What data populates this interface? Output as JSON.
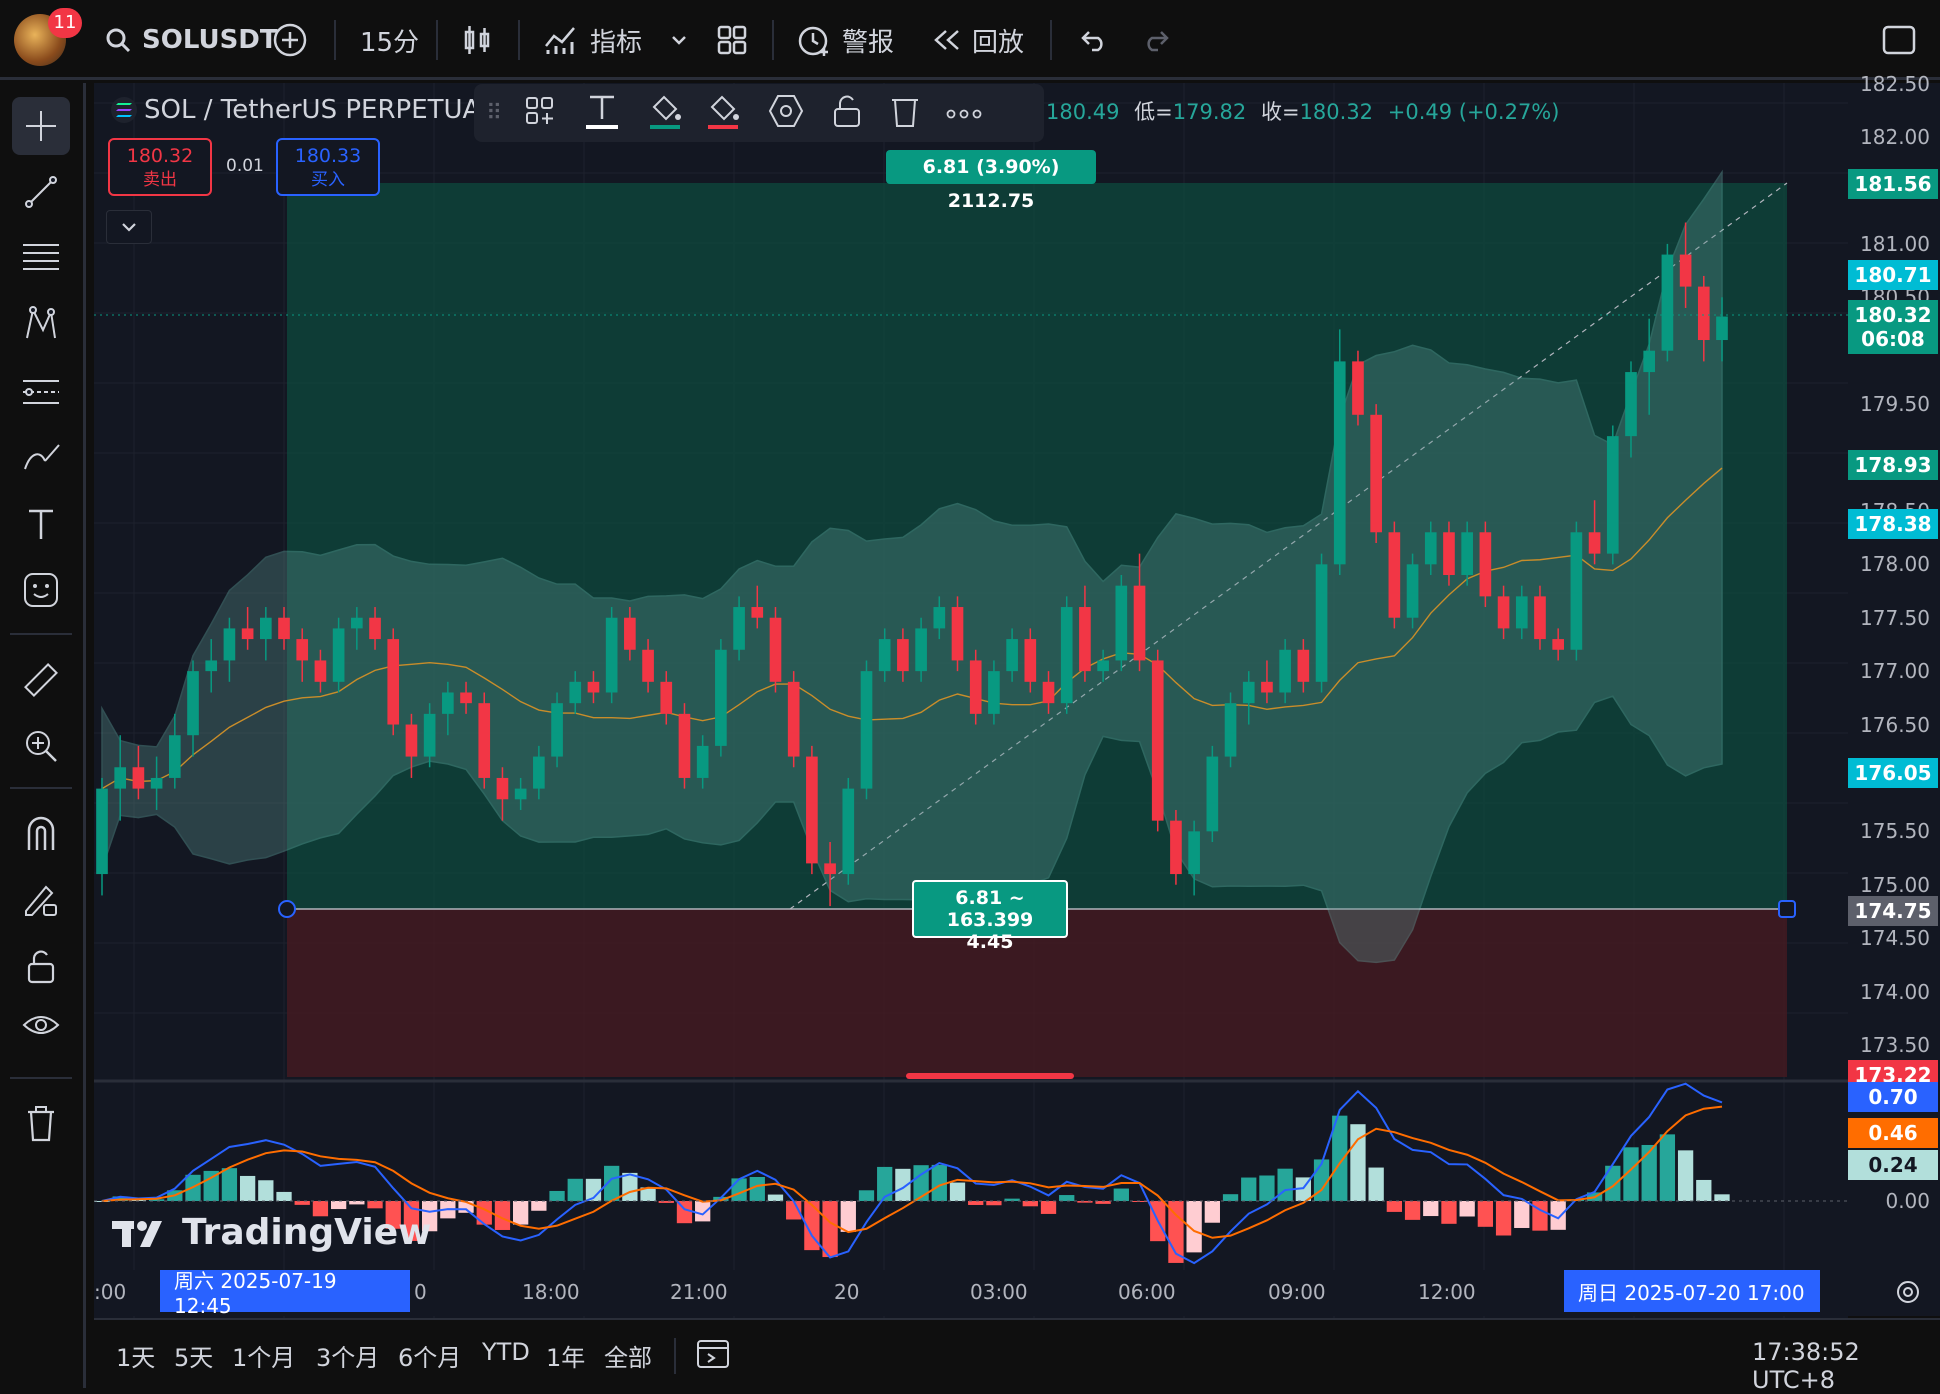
{
  "topbar": {
    "notification_count": "11",
    "symbol": "SOLUSDT",
    "interval": "15分",
    "indicators_label": "指标",
    "alert_label": "警报",
    "replay_label": "回放"
  },
  "legend": {
    "title": "SOL / TetherUS PERPETUA",
    "ohlc_prefix": "180.49",
    "low_label": "低=",
    "low_value": "179.82",
    "close_label": "收=",
    "close_value": "180.32",
    "change": "+0.49 (+0.27%)"
  },
  "trade": {
    "sell_price": "180.32",
    "sell_label": "卖出",
    "spread": "0.01",
    "buy_price": "180.33",
    "buy_label": "买入"
  },
  "position_tool": {
    "top_label": "6.81 (3.90%) 2112.75",
    "mid_label_line1": "6.81 ~ 163.399",
    "mid_label_line2": "4.45"
  },
  "price_axis": {
    "labels": [
      "182.50",
      "182.00",
      "181.00",
      "180.50",
      "179.50",
      "178.50",
      "178.00",
      "177.50",
      "177.00",
      "176.50",
      "175.50",
      "175.00",
      "174.50",
      "174.00",
      "173.50"
    ],
    "tags": [
      {
        "value": "181.56",
        "color": "#089981"
      },
      {
        "value": "180.71",
        "color": "#00bcd4"
      },
      {
        "value": "180.32",
        "sub": "06:08",
        "color": "#089981"
      },
      {
        "value": "178.93",
        "color": "#089981"
      },
      {
        "value": "178.38",
        "color": "#00bcd4"
      },
      {
        "value": "176.05",
        "color": "#00bcd4"
      },
      {
        "value": "174.75",
        "color": "#5d606b"
      },
      {
        "value": "173.22",
        "color": "#f23645"
      }
    ],
    "macd_tags": [
      {
        "value": "0.70",
        "color": "#2962ff"
      },
      {
        "value": "0.46",
        "color": "#ff6d00"
      },
      {
        "value": "0.24",
        "color": "#b2dfdb",
        "text": "#131722"
      }
    ],
    "macd_zero": "0.00"
  },
  "time_axis": {
    "left_cut": ":00",
    "start_tag": "周六 2025-07-19   12:45",
    "after_start": "0",
    "labels": [
      "18:00",
      "21:00",
      "20",
      "03:00",
      "06:00",
      "09:00",
      "12:00"
    ],
    "end_tag": "周日 2025-07-20   17:00"
  },
  "bottombar": {
    "ranges": [
      "1天",
      "5天",
      "1个月",
      "3个月",
      "6个月",
      "YTD",
      "1年",
      "全部"
    ],
    "clock": "17:38:52 UTC+8"
  },
  "watermark": "TradingView",
  "colors": {
    "up": "#089981",
    "down": "#f23645",
    "bg": "#131722",
    "accent": "#2962ff"
  },
  "chart_data": {
    "type": "candlestick",
    "ylim": [
      173.2,
      182.6
    ],
    "candles": [
      [
        175.1,
        176.0,
        174.9,
        175.9
      ],
      [
        175.9,
        176.4,
        175.6,
        176.1
      ],
      [
        176.1,
        176.3,
        175.8,
        175.9
      ],
      [
        175.9,
        176.2,
        175.7,
        176.0
      ],
      [
        176.0,
        176.6,
        175.9,
        176.4
      ],
      [
        176.4,
        177.1,
        176.2,
        177.0
      ],
      [
        177.0,
        177.3,
        176.8,
        177.1
      ],
      [
        177.1,
        177.5,
        176.9,
        177.4
      ],
      [
        177.4,
        177.6,
        177.2,
        177.3
      ],
      [
        177.3,
        177.6,
        177.1,
        177.5
      ],
      [
        177.5,
        177.6,
        177.2,
        177.3
      ],
      [
        177.3,
        177.4,
        176.9,
        177.1
      ],
      [
        177.1,
        177.2,
        176.8,
        176.9
      ],
      [
        176.9,
        177.5,
        176.8,
        177.4
      ],
      [
        177.4,
        177.6,
        177.2,
        177.5
      ],
      [
        177.5,
        177.6,
        177.2,
        177.3
      ],
      [
        177.3,
        177.4,
        176.4,
        176.5
      ],
      [
        176.5,
        176.6,
        176.0,
        176.2
      ],
      [
        176.2,
        176.7,
        176.1,
        176.6
      ],
      [
        176.6,
        176.9,
        176.4,
        176.8
      ],
      [
        176.8,
        176.9,
        176.6,
        176.7
      ],
      [
        176.7,
        176.8,
        175.9,
        176.0
      ],
      [
        176.0,
        176.1,
        175.6,
        175.8
      ],
      [
        175.8,
        176.0,
        175.7,
        175.9
      ],
      [
        175.9,
        176.3,
        175.8,
        176.2
      ],
      [
        176.2,
        176.8,
        176.1,
        176.7
      ],
      [
        176.7,
        177.0,
        176.6,
        176.9
      ],
      [
        176.9,
        177.0,
        176.7,
        176.8
      ],
      [
        176.8,
        177.6,
        176.7,
        177.5
      ],
      [
        177.5,
        177.6,
        177.1,
        177.2
      ],
      [
        177.2,
        177.3,
        176.8,
        176.9
      ],
      [
        176.9,
        177.0,
        176.5,
        176.6
      ],
      [
        176.6,
        176.7,
        175.9,
        176.0
      ],
      [
        176.0,
        176.4,
        175.9,
        176.3
      ],
      [
        176.3,
        177.3,
        176.2,
        177.2
      ],
      [
        177.2,
        177.7,
        177.1,
        177.6
      ],
      [
        177.6,
        177.8,
        177.4,
        177.5
      ],
      [
        177.5,
        177.6,
        176.8,
        176.9
      ],
      [
        176.9,
        177.0,
        176.1,
        176.2
      ],
      [
        176.2,
        176.3,
        175.1,
        175.2
      ],
      [
        175.2,
        175.4,
        174.8,
        175.1
      ],
      [
        175.1,
        176.0,
        175.0,
        175.9
      ],
      [
        175.9,
        177.1,
        175.8,
        177.0
      ],
      [
        177.0,
        177.4,
        176.9,
        177.3
      ],
      [
        177.3,
        177.4,
        176.9,
        177.0
      ],
      [
        177.0,
        177.5,
        176.9,
        177.4
      ],
      [
        177.4,
        177.7,
        177.3,
        177.6
      ],
      [
        177.6,
        177.7,
        177.0,
        177.1
      ],
      [
        177.1,
        177.2,
        176.5,
        176.6
      ],
      [
        176.6,
        177.1,
        176.5,
        177.0
      ],
      [
        177.0,
        177.4,
        176.9,
        177.3
      ],
      [
        177.3,
        177.4,
        176.8,
        176.9
      ],
      [
        176.9,
        177.0,
        176.6,
        176.7
      ],
      [
        176.7,
        177.7,
        176.6,
        177.6
      ],
      [
        177.6,
        177.8,
        176.9,
        177.0
      ],
      [
        177.0,
        177.2,
        176.9,
        177.1
      ],
      [
        177.1,
        177.9,
        177.0,
        177.8
      ],
      [
        177.8,
        178.1,
        177.0,
        177.1
      ],
      [
        177.1,
        177.2,
        175.5,
        175.6
      ],
      [
        175.6,
        175.7,
        175.0,
        175.1
      ],
      [
        175.1,
        175.6,
        174.9,
        175.5
      ],
      [
        175.5,
        176.3,
        175.4,
        176.2
      ],
      [
        176.2,
        176.8,
        176.1,
        176.7
      ],
      [
        176.7,
        177.0,
        176.5,
        176.9
      ],
      [
        176.9,
        177.1,
        176.7,
        176.8
      ],
      [
        176.8,
        177.3,
        176.7,
        177.2
      ],
      [
        177.2,
        177.3,
        176.8,
        176.9
      ],
      [
        176.9,
        178.1,
        176.8,
        178.0
      ],
      [
        178.0,
        180.2,
        177.9,
        179.9
      ],
      [
        179.9,
        180.0,
        179.3,
        179.4
      ],
      [
        179.4,
        179.5,
        178.2,
        178.3
      ],
      [
        178.3,
        178.4,
        177.4,
        177.5
      ],
      [
        177.5,
        178.1,
        177.4,
        178.0
      ],
      [
        178.0,
        178.4,
        177.9,
        178.3
      ],
      [
        178.3,
        178.4,
        177.8,
        177.9
      ],
      [
        177.9,
        178.4,
        177.8,
        178.3
      ],
      [
        178.3,
        178.4,
        177.6,
        177.7
      ],
      [
        177.7,
        177.8,
        177.3,
        177.4
      ],
      [
        177.4,
        177.8,
        177.3,
        177.7
      ],
      [
        177.7,
        177.8,
        177.2,
        177.3
      ],
      [
        177.3,
        177.4,
        177.1,
        177.2
      ],
      [
        177.2,
        178.4,
        177.1,
        178.3
      ],
      [
        178.3,
        178.6,
        178.0,
        178.1
      ],
      [
        178.1,
        179.3,
        178.0,
        179.2
      ],
      [
        179.2,
        179.9,
        179.0,
        179.8
      ],
      [
        179.8,
        180.3,
        179.4,
        180.0
      ],
      [
        180.0,
        181.0,
        179.9,
        180.9
      ],
      [
        180.9,
        181.2,
        180.4,
        180.6
      ],
      [
        180.6,
        180.7,
        179.9,
        180.1
      ],
      [
        180.1,
        180.5,
        179.9,
        180.32
      ]
    ]
  }
}
